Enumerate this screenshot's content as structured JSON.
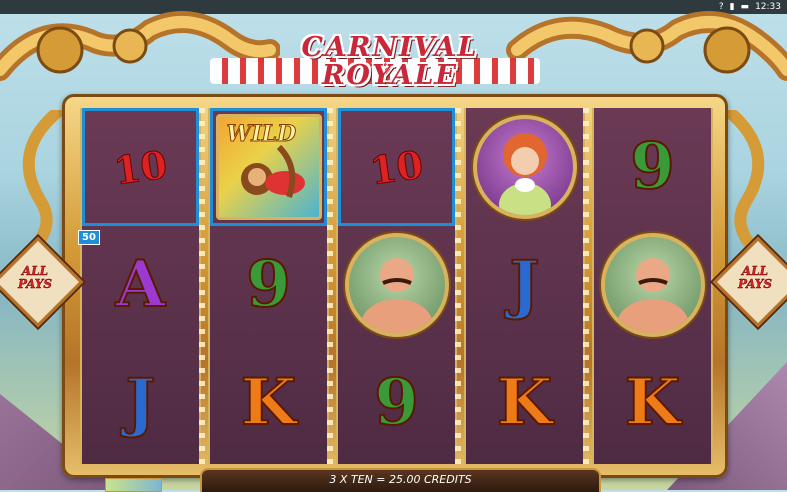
{
  "status": {
    "help": "?",
    "time": "12:33"
  },
  "game": {
    "title_line1": "CARNIVAL",
    "title_line2": "ROYALE"
  },
  "feature": {
    "label_line1": "ALL",
    "label_line2": "PAYS"
  },
  "line_badge": "50",
  "reels": [
    [
      "10",
      "A",
      "J"
    ],
    [
      "WILD",
      "9",
      "K"
    ],
    [
      "10",
      "strongman",
      "9"
    ],
    [
      "lady",
      "J",
      "K"
    ],
    [
      "9",
      "strongman",
      "K"
    ]
  ],
  "wild_label": "WILD",
  "win_message": "3 X TEN  =  25.00 CREDITS",
  "colors": {
    "accent_gold": "#d9b25e",
    "reel_bg": "#5b3249",
    "highlight": "#1e8fd6"
  }
}
